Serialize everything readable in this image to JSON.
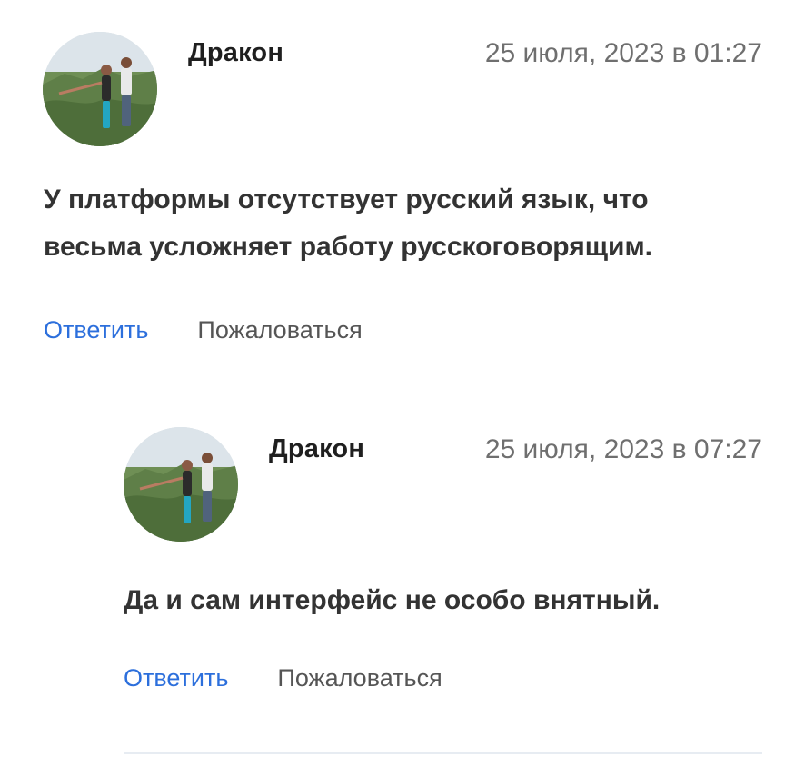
{
  "comments": [
    {
      "author": "Дракон",
      "date": "25 июля, 2023 в 01:27",
      "text": "У платформы отсутствует русский язык, что весьма усложняет работу русскоговорящим.",
      "reply_label": "Ответить",
      "report_label": "Пожаловаться"
    },
    {
      "author": "Дракон",
      "date": "25 июля, 2023 в 07:27",
      "text": "Да и сам интерфейс не особо внятный.",
      "reply_label": "Ответить",
      "report_label": "Пожаловаться"
    }
  ],
  "colors": {
    "link": "#2c6fdc",
    "date": "#6f6f6f",
    "text": "#333333"
  }
}
